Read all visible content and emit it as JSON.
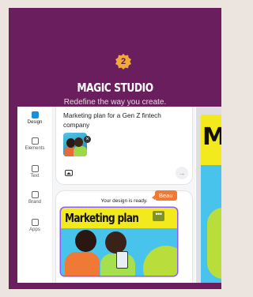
{
  "promo": {
    "step_number": "2",
    "title": "MAGIC STUDIO",
    "subtitle": "Redefine the way you create."
  },
  "sidebar": {
    "items": [
      {
        "label": "Design",
        "icon": "design-icon",
        "active": true
      },
      {
        "label": "Elements",
        "icon": "elements-icon",
        "active": false
      },
      {
        "label": "Text",
        "icon": "text-icon",
        "active": false
      },
      {
        "label": "Brand",
        "icon": "brand-icon",
        "active": false
      },
      {
        "label": "Apps",
        "icon": "apps-icon",
        "active": false
      }
    ]
  },
  "prompt": {
    "text": "Marketing plan for a Gen Z fintech company",
    "attachment_remove": "×",
    "send_symbol": "→"
  },
  "result": {
    "message": "Your design is ready.",
    "design_title": "Marketing plan",
    "more_symbol": "•••"
  },
  "collaborator": {
    "name": "Beau",
    "color": "#f07a35"
  },
  "canvas": {
    "visible_letter": "M"
  },
  "colors": {
    "background": "#ece5df",
    "card": "#6a1e5e",
    "badge": "#f2a93b",
    "design_yellow": "#f3ea1e",
    "design_blue": "#47c3ec",
    "accent_blue": "#1a8fd9"
  }
}
